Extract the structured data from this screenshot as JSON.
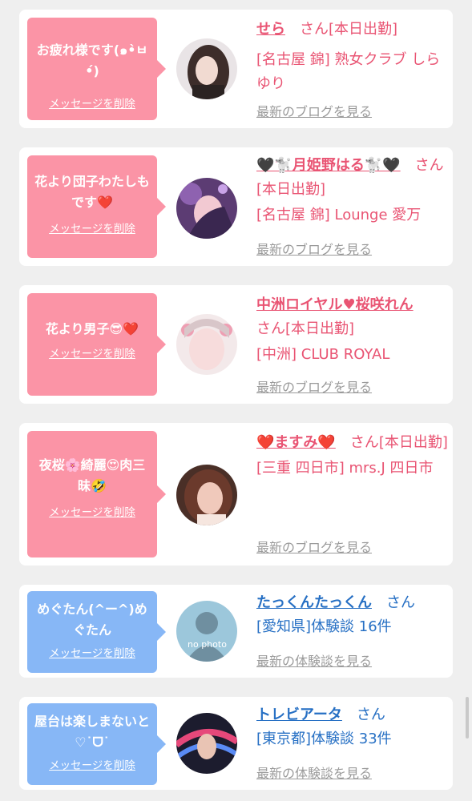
{
  "cards": [
    {
      "bubble_text": "お疲れ様です(๑•̀ㅂ•́)",
      "delete_label": "メッセージを削除",
      "name": "せら",
      "suffix": "　さん[本日出勤]",
      "location": "[名古屋 錦] 熟女クラブ しらゆり",
      "link_label": "最新のブログを見る"
    },
    {
      "bubble_text": "花より団子わたしもです❤️",
      "delete_label": "メッセージを削除",
      "name": "🖤🐩月姫野はる🐩🖤",
      "suffix": "　さん[本日出勤]",
      "location": "[名古屋 錦] Lounge 愛万",
      "link_label": "最新のブログを見る"
    },
    {
      "bubble_text": "花より男子😎❤️",
      "delete_label": "メッセージを削除",
      "name": "中洲ロイヤル♥桜咲れん",
      "suffix": "さん[本日出勤]",
      "location": "[中洲] CLUB ROYAL",
      "link_label": "最新のブログを見る"
    },
    {
      "bubble_text": "夜桜🌸綺麗😍肉三昧🤣",
      "delete_label": "メッセージを削除",
      "name": "❤️ますみ❤️",
      "suffix": "　さん[本日出勤]",
      "location": "[三重 四日市] mrs.J 四日市",
      "link_label": "最新のブログを見る"
    },
    {
      "bubble_text": "めぐたん(^ー^)めぐたん",
      "delete_label": "メッセージを削除",
      "name": "たっくんたっくん",
      "suffix": "　さん",
      "location": "[愛知県]体験談 16件",
      "link_label": "最新の体験談を見る",
      "avatar_text": "no photo"
    },
    {
      "bubble_text": "屋台は楽しまないと♡˙ᗜ˙",
      "delete_label": "メッセージを削除",
      "name": "トレビアータ",
      "suffix": "　さん",
      "location": "[東京都]体験談 33件",
      "link_label": "最新の体験談を見る"
    }
  ],
  "colors": {
    "pink_bubble": "#fb94a6",
    "blue_bubble": "#87b7f6",
    "pink_text": "#e95473",
    "blue_text": "#2770c4"
  }
}
